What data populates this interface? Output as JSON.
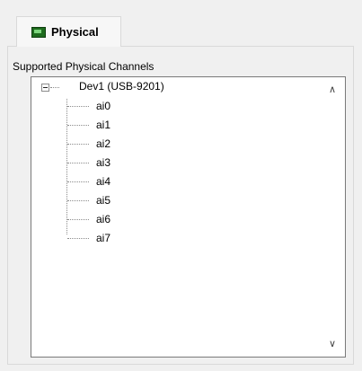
{
  "tab": {
    "label": "Physical",
    "icon": "device-card-icon"
  },
  "group": {
    "label": "Supported Physical Channels"
  },
  "tree": {
    "root": {
      "label": "Dev1  (USB-9201)",
      "expanded": true
    },
    "children": [
      "ai0",
      "ai1",
      "ai2",
      "ai3",
      "ai4",
      "ai5",
      "ai6",
      "ai7"
    ]
  },
  "scrollbar": {
    "up": "∧",
    "down": "∨"
  }
}
